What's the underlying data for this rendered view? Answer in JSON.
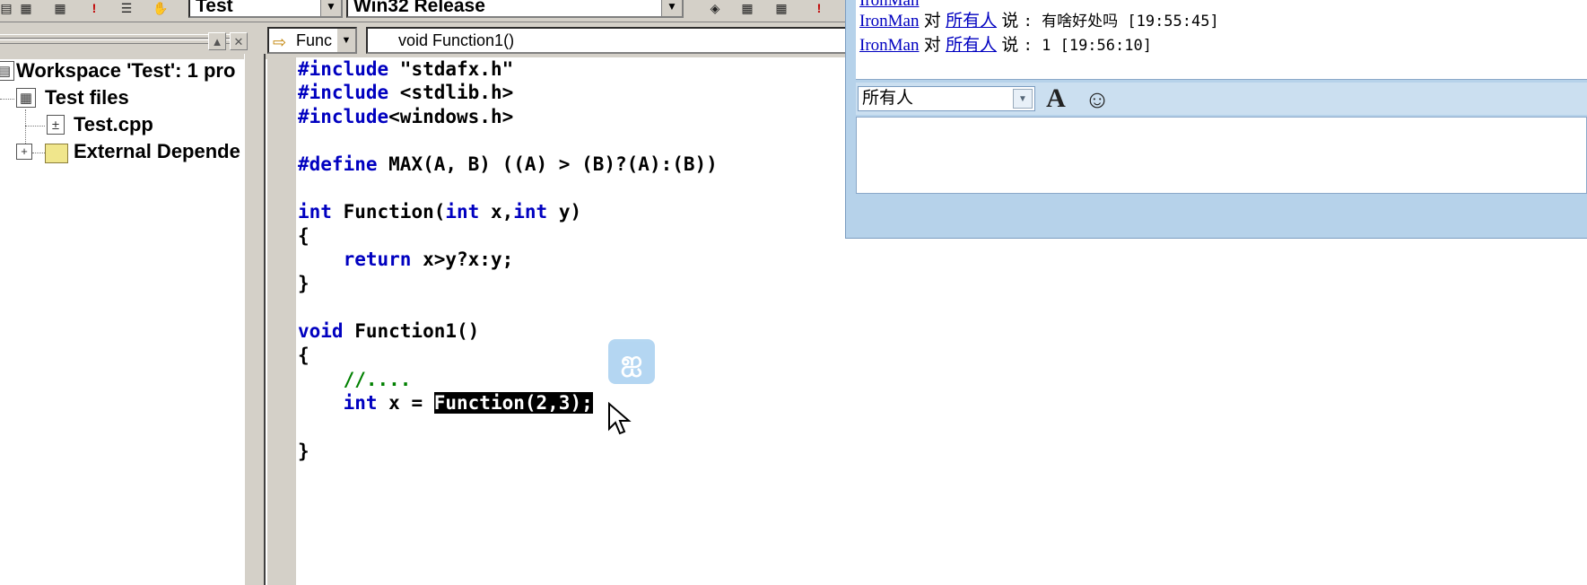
{
  "toolbar": {
    "project_combo": "Test",
    "config_combo": "Win32 Release"
  },
  "workspace": {
    "items": [
      {
        "label": "Workspace 'Test': 1 pro"
      },
      {
        "label": "Test files"
      },
      {
        "label": "Test.cpp"
      },
      {
        "label": "External Depende"
      }
    ]
  },
  "editor": {
    "function_combo": "Func",
    "member_combo": "void Function1()",
    "code": {
      "l1a": "#include",
      "l1b": " \"stdafx.h\"",
      "l2a": "#include",
      "l2b": " <stdlib.h>",
      "l3a": "#include",
      "l3b": "<windows.h>",
      "l4a": "#define",
      "l4b": " MAX(A, B) ((A) > (B)?(A):(B))",
      "l5a": "int",
      "l5b": " Function(",
      "l5c": "int",
      "l5d": " x,",
      "l5e": "int",
      "l5f": " y)",
      "l6": "{",
      "l7a": "    ",
      "l7b": "return",
      "l7c": " x>y?x:y;",
      "l8": "}",
      "l9a": "void",
      "l9b": " Function1()",
      "l10": "{",
      "l11": "    //....",
      "l12a": "    ",
      "l12b": "int",
      "l12c": " x = ",
      "l12d": "Function(2,3);",
      "l13": "}"
    }
  },
  "chat": {
    "messages": [
      {
        "user": "IronMan",
        "to_word": "对",
        "target": "所有人",
        "say": "说",
        "text": ": 有啥好处吗 [19:55:45]"
      },
      {
        "user": "IronMan",
        "to_word": "对",
        "target": "所有人",
        "say": "说",
        "text": ": 1 [19:56:10]"
      }
    ],
    "recipient": "所有人",
    "font_btn": "A",
    "emoji_btn": "☺"
  },
  "colors": {
    "keyword": "#0000c0",
    "comment": "#008000",
    "chat_bg": "#b6d2ea"
  }
}
